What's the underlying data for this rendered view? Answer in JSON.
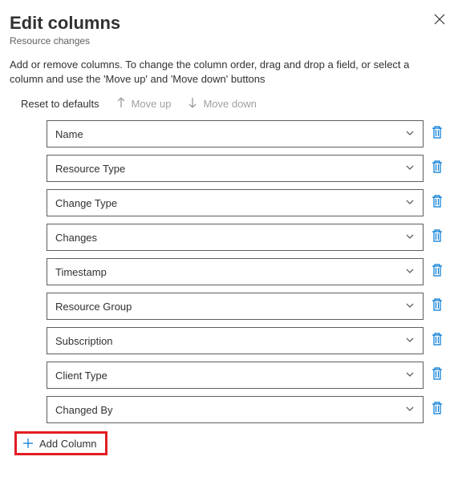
{
  "header": {
    "title": "Edit columns",
    "subtitle": "Resource changes"
  },
  "description": "Add or remove columns. To change the column order, drag and drop a field, or select a column and use the 'Move up' and 'Move down' buttons",
  "toolbar": {
    "reset": "Reset to defaults",
    "move_up": "Move up",
    "move_down": "Move down"
  },
  "columns": [
    {
      "label": "Name"
    },
    {
      "label": "Resource Type"
    },
    {
      "label": "Change Type"
    },
    {
      "label": "Changes"
    },
    {
      "label": "Timestamp"
    },
    {
      "label": "Resource Group"
    },
    {
      "label": "Subscription"
    },
    {
      "label": "Client Type"
    },
    {
      "label": "Changed By"
    }
  ],
  "add_button": "Add Column"
}
